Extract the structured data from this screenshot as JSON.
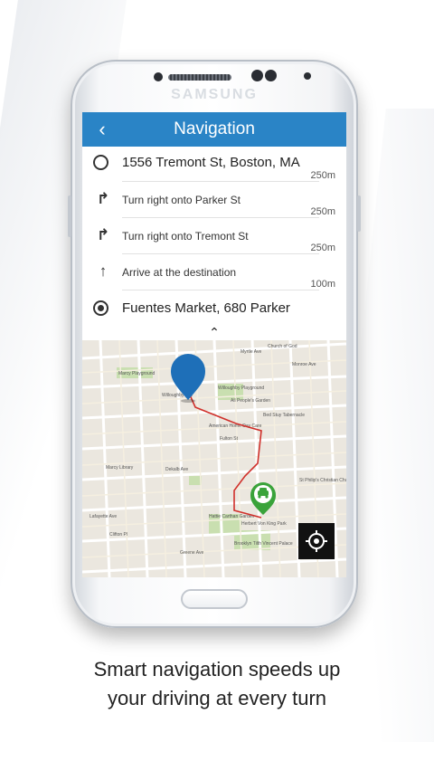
{
  "device": {
    "brand": "SAMSUNG"
  },
  "app": {
    "title": "Navigation",
    "back_icon": "chevron-left-icon",
    "accent_color": "#2a84c6"
  },
  "route": {
    "origin": "1556 Tremont St, Boston, MA",
    "steps": [
      {
        "distance": "250m",
        "instruction": "Turn right onto  Parker St",
        "icon": "turn-right-icon"
      },
      {
        "distance": "250m",
        "instruction": "Turn right onto Tremont St",
        "icon": "turn-right-icon"
      },
      {
        "distance": "250m",
        "instruction": "Arrive at the destination",
        "icon": "arrow-up-icon"
      }
    ],
    "final_distance": "100m",
    "destination": "Fuentes Market, 680 Parker"
  },
  "map": {
    "labels": [
      "Myrtle Ave",
      "Willoughby Ave",
      "Willoughby Playground",
      "Monroe Ave",
      "Marcy Playground",
      "Dekalb Ave",
      "Lafayette Ave",
      "Clifton Pl",
      "Greene Ave",
      "Fulton St",
      "Marcy Library",
      "St Philip's Christian Church",
      "Hattie Carthan Garden",
      "Brooklyn Tilth Vincent Palace",
      "Church of God",
      "American Home Day Care",
      "Bed Stuy Tabernacle",
      "All People's Garden",
      "Herbert Von King Park"
    ],
    "route_color": "#d0302b",
    "pin_color": "#1e6fb8",
    "marker_color": "#3aa33a"
  },
  "caption": {
    "line1": "Smart navigation speeds up",
    "line2": "your driving at every turn"
  }
}
